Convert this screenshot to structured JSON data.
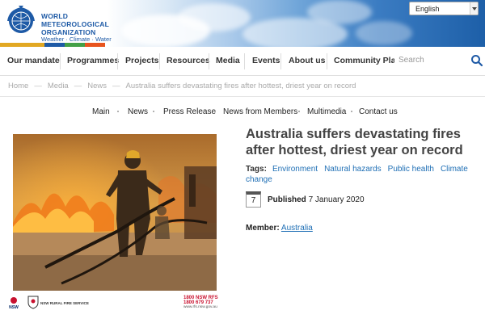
{
  "header": {
    "org_line1": "WORLD",
    "org_line2": "METEOROLOGICAL",
    "org_line3": "ORGANIZATION",
    "tagline": "Weather · Climate · Water",
    "language_selected": "English",
    "stripe_colors": [
      "#e2a822",
      "#1e5aa6",
      "#43a047",
      "#e8541e",
      "#1a8fd6"
    ]
  },
  "nav": {
    "items": [
      "Our mandate",
      "Programmes",
      "Projects",
      "Resources",
      "Media",
      "Events",
      "About us",
      "Community Platfc"
    ],
    "search_placeholder": "Search"
  },
  "breadcrumb": {
    "items": [
      "Home",
      "Media",
      "News",
      "Australia suffers devastating fires after hottest, driest year on record"
    ]
  },
  "subnav": {
    "items": [
      "Main",
      "News",
      "Press Release",
      "News from Members",
      "Multimedia",
      "Contact us"
    ]
  },
  "photo": {
    "logo_left": "NSW",
    "rfs_name": "NSW RURAL FIRE SERVICE",
    "hotline_line1": "1800 NSW RFS",
    "hotline_line2": "1800 679 737",
    "hotline_url": "www.rfs.nsw.gov.au"
  },
  "article": {
    "title": "Australia suffers devastating fires after hottest, driest year on record",
    "tags_label": "Tags:",
    "tags": [
      "Environment",
      "Natural hazards",
      "Public health",
      "Climate change"
    ],
    "calendar_day": "7",
    "published_label": "Published",
    "published_date": "7 January 2020",
    "member_label": "Member:",
    "member_value": "Australia"
  },
  "colors": {
    "link": "#1f6fb5",
    "brand": "#1e5aa6"
  }
}
